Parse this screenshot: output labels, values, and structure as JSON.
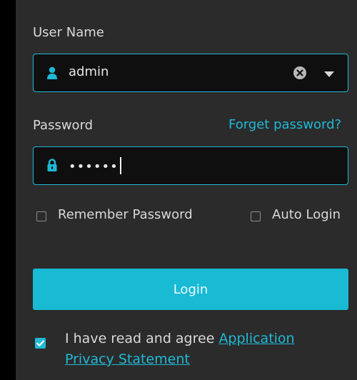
{
  "username": {
    "label": "User Name",
    "value": "admin"
  },
  "password": {
    "label": "Password",
    "forgot_link": "Forget password?",
    "masked_value": "••••••"
  },
  "options": {
    "remember_label": "Remember Password",
    "auto_login_label": "Auto Login",
    "remember_checked": false,
    "auto_login_checked": false
  },
  "login": {
    "button_label": "Login"
  },
  "agreement": {
    "checked": true,
    "text_prefix": "I have read and agree ",
    "link_text": "Application Privacy Statement"
  },
  "colors": {
    "background": "#2b2b2b",
    "accent": "#1fb9d6",
    "input_background": "#0f0f0f",
    "text": "#d9d9d9"
  },
  "icons": {
    "user": "user-icon",
    "clear": "clear-icon",
    "dropdown": "chevron-down-icon",
    "lock": "lock-icon",
    "check": "check-icon"
  }
}
